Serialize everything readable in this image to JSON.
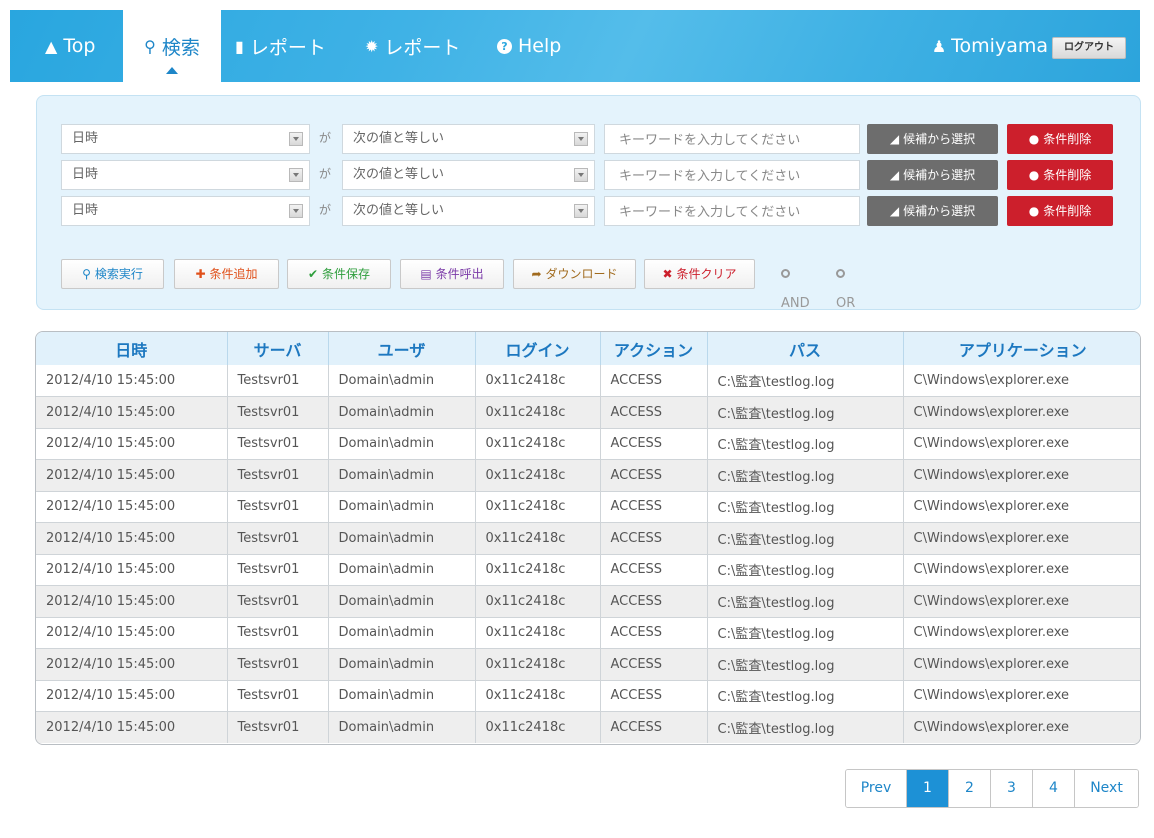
{
  "nav": {
    "items": [
      {
        "label": "Top",
        "icon": "home-icon",
        "glyph": "⬆"
      },
      {
        "label": "検索",
        "icon": "search-icon",
        "glyph": "⚲"
      },
      {
        "label": "レポート",
        "icon": "document-icon",
        "glyph": "▉"
      },
      {
        "label": "レポート",
        "icon": "gear-icon",
        "glyph": "✹"
      },
      {
        "label": "Help",
        "icon": "help-icon",
        "glyph": "?"
      }
    ],
    "active_index": 1,
    "user": {
      "name": "Tomiyama",
      "icon": "user-icon",
      "glyph": "♟"
    },
    "logout_label": "ログアウト"
  },
  "conditions": [
    {
      "field": "日時",
      "ga": "が",
      "operator": "次の値と等しい",
      "keyword_placeholder": "キーワードを入力してください",
      "candidate_label": "候補から選択",
      "delete_label": "条件削除"
    },
    {
      "field": "日時",
      "ga": "が",
      "operator": "次の値と等しい",
      "keyword_placeholder": "キーワードを入力してください",
      "candidate_label": "候補から選択",
      "delete_label": "条件削除"
    },
    {
      "field": "日時",
      "ga": "が",
      "operator": "次の値と等しい",
      "keyword_placeholder": "キーワードを入力してください",
      "candidate_label": "候補から選択",
      "delete_label": "条件削除"
    }
  ],
  "actions": {
    "search": {
      "label": "検索実行",
      "color": "#1e86c8"
    },
    "add": {
      "label": "条件追加",
      "color": "#e0501a"
    },
    "save": {
      "label": "条件保存",
      "color": "#2e9e3c"
    },
    "load": {
      "label": "条件呼出",
      "color": "#7b3aa8"
    },
    "download": {
      "label": "ダウンロード",
      "color": "#a06a1d"
    },
    "clear": {
      "label": "条件クリア",
      "color": "#cc1f2c"
    },
    "and_label": "AND",
    "or_label": "OR"
  },
  "table": {
    "headers": [
      "日時",
      "サーバ",
      "ユーザ",
      "ログイン",
      "アクション",
      "パス",
      "アプリケーション"
    ],
    "rows": [
      [
        "2012/4/10  15:45:00",
        "Testsvr01",
        "Domain\\admin",
        "0x11c2418c",
        "ACCESS",
        "C:\\監査\\testlog.log",
        "C\\Windows\\explorer.exe"
      ],
      [
        "2012/4/10  15:45:00",
        "Testsvr01",
        "Domain\\admin",
        "0x11c2418c",
        "ACCESS",
        "C:\\監査\\testlog.log",
        "C\\Windows\\explorer.exe"
      ],
      [
        "2012/4/10  15:45:00",
        "Testsvr01",
        "Domain\\admin",
        "0x11c2418c",
        "ACCESS",
        "C:\\監査\\testlog.log",
        "C\\Windows\\explorer.exe"
      ],
      [
        "2012/4/10  15:45:00",
        "Testsvr01",
        "Domain\\admin",
        "0x11c2418c",
        "ACCESS",
        "C:\\監査\\testlog.log",
        "C\\Windows\\explorer.exe"
      ],
      [
        "2012/4/10  15:45:00",
        "Testsvr01",
        "Domain\\admin",
        "0x11c2418c",
        "ACCESS",
        "C:\\監査\\testlog.log",
        "C\\Windows\\explorer.exe"
      ],
      [
        "2012/4/10  15:45:00",
        "Testsvr01",
        "Domain\\admin",
        "0x11c2418c",
        "ACCESS",
        "C:\\監査\\testlog.log",
        "C\\Windows\\explorer.exe"
      ],
      [
        "2012/4/10  15:45:00",
        "Testsvr01",
        "Domain\\admin",
        "0x11c2418c",
        "ACCESS",
        "C:\\監査\\testlog.log",
        "C\\Windows\\explorer.exe"
      ],
      [
        "2012/4/10  15:45:00",
        "Testsvr01",
        "Domain\\admin",
        "0x11c2418c",
        "ACCESS",
        "C:\\監査\\testlog.log",
        "C\\Windows\\explorer.exe"
      ],
      [
        "2012/4/10  15:45:00",
        "Testsvr01",
        "Domain\\admin",
        "0x11c2418c",
        "ACCESS",
        "C:\\監査\\testlog.log",
        "C\\Windows\\explorer.exe"
      ],
      [
        "2012/4/10  15:45:00",
        "Testsvr01",
        "Domain\\admin",
        "0x11c2418c",
        "ACCESS",
        "C:\\監査\\testlog.log",
        "C\\Windows\\explorer.exe"
      ],
      [
        "2012/4/10  15:45:00",
        "Testsvr01",
        "Domain\\admin",
        "0x11c2418c",
        "ACCESS",
        "C:\\監査\\testlog.log",
        "C\\Windows\\explorer.exe"
      ],
      [
        "2012/4/10  15:45:00",
        "Testsvr01",
        "Domain\\admin",
        "0x11c2418c",
        "ACCESS",
        "C:\\監査\\testlog.log",
        "C\\Windows\\explorer.exe"
      ]
    ]
  },
  "pagination": {
    "prev_label": "Prev",
    "pages": [
      "1",
      "2",
      "3",
      "4"
    ],
    "current_page": "1",
    "next_label": "Next"
  }
}
